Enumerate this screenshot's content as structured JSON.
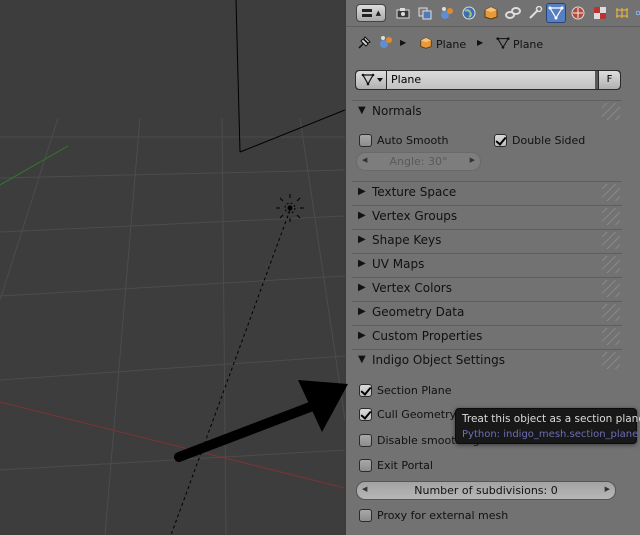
{
  "header": {
    "editor_type_icon": "editor-type-menu-icon",
    "tabs": [
      {
        "name": "render-icon"
      },
      {
        "name": "render-layers-icon"
      },
      {
        "name": "scene-icon"
      },
      {
        "name": "world-icon"
      },
      {
        "name": "object-icon"
      },
      {
        "name": "constraints-icon"
      },
      {
        "name": "modifiers-icon"
      },
      {
        "name": "mesh-data-icon",
        "active": true
      },
      {
        "name": "material-icon"
      },
      {
        "name": "texture-icon"
      },
      {
        "name": "particles-icon"
      },
      {
        "name": "physics-icon"
      }
    ]
  },
  "breadcrumb": {
    "pin_icon": "pin-icon",
    "scene_icon": "scene-icon",
    "object_label": "Plane",
    "mesh_label": "Plane"
  },
  "datablock": {
    "name": "Plane",
    "fake_user": "F"
  },
  "normals": {
    "title": "Normals",
    "auto_smooth": {
      "label": "Auto Smooth",
      "checked": false
    },
    "double_sided": {
      "label": "Double Sided",
      "checked": true
    },
    "angle": "Angle: 30°"
  },
  "panels": {
    "texture_space": "Texture Space",
    "vertex_groups": "Vertex Groups",
    "shape_keys": "Shape Keys",
    "uv_maps": "UV Maps",
    "vertex_colors": "Vertex Colors",
    "geometry_data": "Geometry Data",
    "custom_properties": "Custom Properties"
  },
  "indigo": {
    "title": "Indigo Object Settings",
    "section_plane": {
      "label": "Section Plane",
      "checked": true
    },
    "cull_geometry": {
      "label": "Cull Geometry",
      "checked": true
    },
    "disable_smoothing": {
      "label": "Disable smoothing",
      "checked": false
    },
    "exit_portal": {
      "label": "Exit Portal",
      "checked": false
    },
    "subdivisions": "Number of subdivisions: 0",
    "proxy": {
      "label": "Proxy for external mesh",
      "checked": false
    }
  },
  "tooltip": {
    "text": "Treat this object as a section plane",
    "python": "Python: indigo_mesh.section_plane"
  },
  "colors": {
    "panel_bg": "#727272",
    "viewport_bg": "#3d3d3d",
    "active_tab": "#5680c2",
    "tooltip_bg": "#181818",
    "python_text": "#6d6db4"
  }
}
